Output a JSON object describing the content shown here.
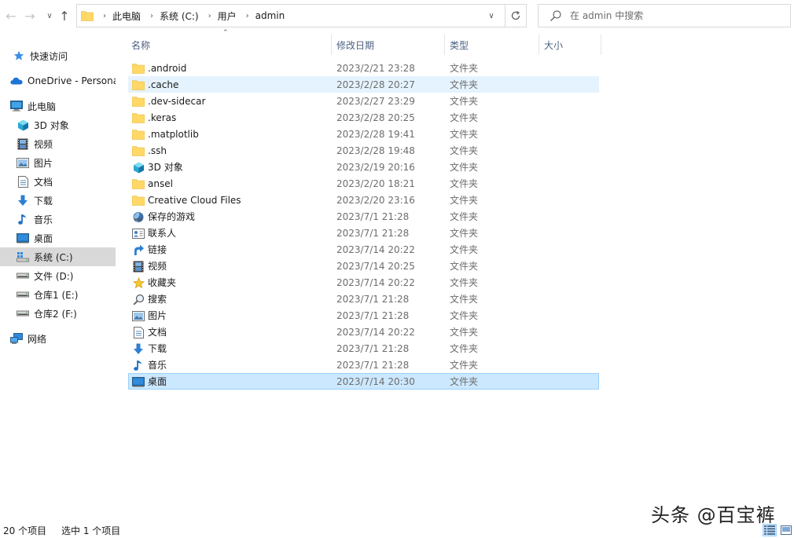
{
  "address": {
    "segments": [
      "此电脑",
      "系统 (C:)",
      "用户",
      "admin"
    ]
  },
  "search": {
    "placeholder": "在 admin 中搜索"
  },
  "sidebar": {
    "items": [
      {
        "label": "快速访问",
        "icon": "star-icon"
      },
      {
        "label": "OneDrive - Personal",
        "icon": "cloud-icon"
      },
      {
        "label": "此电脑",
        "icon": "computer-icon"
      },
      {
        "label": "3D 对象",
        "icon": "cube-icon"
      },
      {
        "label": "视频",
        "icon": "film-icon"
      },
      {
        "label": "图片",
        "icon": "picture-icon"
      },
      {
        "label": "文档",
        "icon": "document-icon"
      },
      {
        "label": "下载",
        "icon": "download-icon"
      },
      {
        "label": "音乐",
        "icon": "music-icon"
      },
      {
        "label": "桌面",
        "icon": "desktop-icon"
      },
      {
        "label": "系统 (C:)",
        "icon": "system-drive-icon",
        "selected": true
      },
      {
        "label": "文件 (D:)",
        "icon": "drive-icon"
      },
      {
        "label": "仓库1 (E:)",
        "icon": "drive-icon"
      },
      {
        "label": "仓库2 (F:)",
        "icon": "drive-icon"
      },
      {
        "label": "网络",
        "icon": "network-icon"
      }
    ]
  },
  "columns": {
    "name": "名称",
    "date": "修改日期",
    "type": "类型",
    "size": "大小"
  },
  "files": [
    {
      "name": ".android",
      "date": "2023/2/21 23:28",
      "type": "文件夹",
      "icon": "folder-icon"
    },
    {
      "name": ".cache",
      "date": "2023/2/28 20:27",
      "type": "文件夹",
      "icon": "folder-icon",
      "state": "hover"
    },
    {
      "name": ".dev-sidecar",
      "date": "2023/2/27 23:29",
      "type": "文件夹",
      "icon": "folder-icon"
    },
    {
      "name": ".keras",
      "date": "2023/2/28 20:25",
      "type": "文件夹",
      "icon": "folder-icon"
    },
    {
      "name": ".matplotlib",
      "date": "2023/2/28 19:41",
      "type": "文件夹",
      "icon": "folder-icon"
    },
    {
      "name": ".ssh",
      "date": "2023/2/28 19:48",
      "type": "文件夹",
      "icon": "folder-icon"
    },
    {
      "name": "3D 对象",
      "date": "2023/2/19 20:16",
      "type": "文件夹",
      "icon": "cube-icon"
    },
    {
      "name": "ansel",
      "date": "2023/2/20 18:21",
      "type": "文件夹",
      "icon": "folder-icon"
    },
    {
      "name": "Creative Cloud Files",
      "date": "2023/2/20 23:16",
      "type": "文件夹",
      "icon": "folder-icon"
    },
    {
      "name": "保存的游戏",
      "date": "2023/7/1 21:28",
      "type": "文件夹",
      "icon": "saved-games-icon"
    },
    {
      "name": "联系人",
      "date": "2023/7/1 21:28",
      "type": "文件夹",
      "icon": "contacts-icon"
    },
    {
      "name": "链接",
      "date": "2023/7/14 20:22",
      "type": "文件夹",
      "icon": "link-icon"
    },
    {
      "name": "视频",
      "date": "2023/7/14 20:25",
      "type": "文件夹",
      "icon": "film-icon"
    },
    {
      "name": "收藏夹",
      "date": "2023/7/14 20:22",
      "type": "文件夹",
      "icon": "favorites-icon"
    },
    {
      "name": "搜索",
      "date": "2023/7/1 21:28",
      "type": "文件夹",
      "icon": "search-icon"
    },
    {
      "name": "图片",
      "date": "2023/7/1 21:28",
      "type": "文件夹",
      "icon": "picture-icon"
    },
    {
      "name": "文档",
      "date": "2023/7/14 20:22",
      "type": "文件夹",
      "icon": "document-icon"
    },
    {
      "name": "下载",
      "date": "2023/7/1 21:28",
      "type": "文件夹",
      "icon": "download-icon"
    },
    {
      "name": "音乐",
      "date": "2023/7/1 21:28",
      "type": "文件夹",
      "icon": "music-icon"
    },
    {
      "name": "桌面",
      "date": "2023/7/14 20:30",
      "type": "文件夹",
      "icon": "desktop-icon",
      "state": "selected"
    }
  ],
  "status": {
    "item_count": "20 个项目",
    "selected_count": "选中 1 个项目"
  },
  "watermark": "头条 @百宝裤"
}
